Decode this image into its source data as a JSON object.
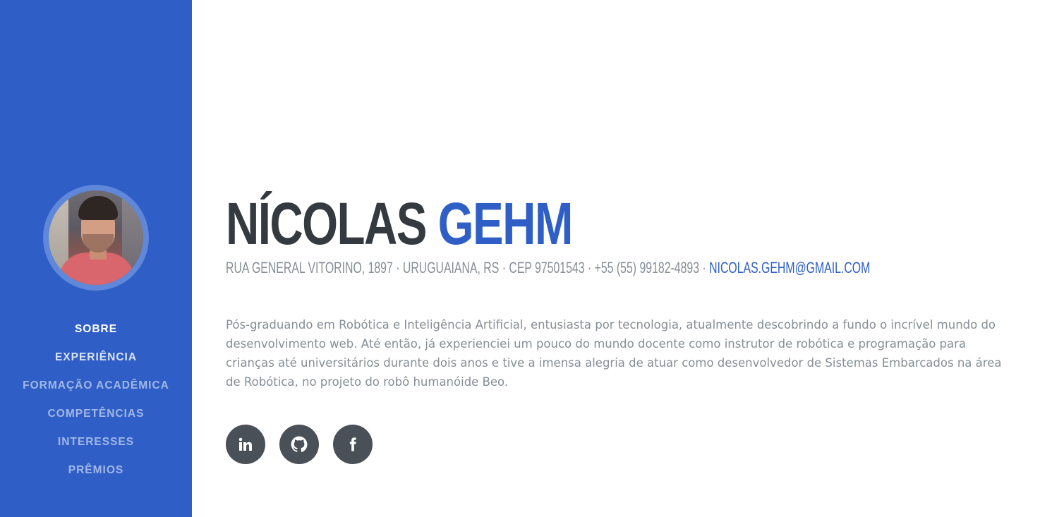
{
  "profile": {
    "photo_alt": "profile-photo"
  },
  "nav": {
    "items": [
      {
        "label": "Sobre"
      },
      {
        "label": "Experiência"
      },
      {
        "label": "Formação Acadêmica"
      },
      {
        "label": "Competências"
      },
      {
        "label": "Interesses"
      },
      {
        "label": "Prêmios"
      }
    ]
  },
  "header": {
    "first_name": "NÍCOLAS",
    "last_name": "GEHM",
    "address": "RUA GENERAL VITORINO, 1897 · URUGUAIANA, RS · CEP 97501543 · +55 (55) 99182-4893 ·",
    "email": "NICOLAS.GEHM@GMAIL.COM"
  },
  "bio": "Pós-graduando em Robótica e Inteligência Artificial, entusiasta por tecnologia, atualmente descobrindo a fundo o incrível mundo do desenvolvimento web. Até então, já experienciei um pouco do mundo docente como instrutor de robótica e programação para crianças até universitários durante dois anos e tive a imensa alegria de atuar como desenvolvedor de Sistemas Embarcados na área de Robótica, no projeto do robô humanóide Beo.",
  "social": [
    {
      "icon": "linkedin-icon"
    },
    {
      "icon": "github-icon"
    },
    {
      "icon": "facebook-icon"
    }
  ],
  "colors": {
    "primary": "#2f5fc6",
    "dark": "#343a40",
    "muted": "#868e96",
    "social_bg": "#495057"
  }
}
